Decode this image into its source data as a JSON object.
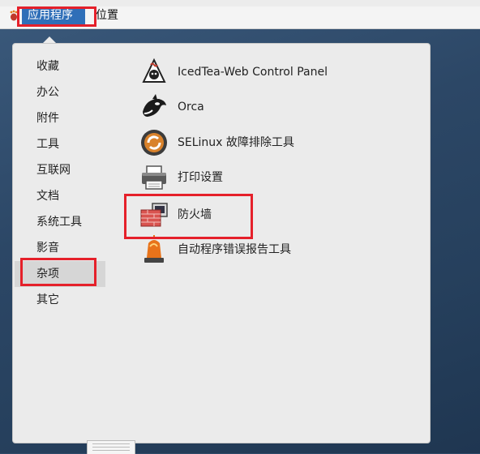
{
  "topbar": {
    "applications_label": "应用程序",
    "places_label": "位置"
  },
  "menu": {
    "categories": [
      {
        "label": "收藏"
      },
      {
        "label": "办公"
      },
      {
        "label": "附件"
      },
      {
        "label": "工具"
      },
      {
        "label": "互联网"
      },
      {
        "label": "文档"
      },
      {
        "label": "系统工具"
      },
      {
        "label": "影音"
      },
      {
        "label": "杂项",
        "selected": true
      },
      {
        "label": "其它"
      }
    ],
    "apps": [
      {
        "label": "IcedTea-Web Control Panel",
        "icon": "java-icon"
      },
      {
        "label": "Orca",
        "icon": "orca-icon"
      },
      {
        "label": "SELinux 故障排除工具",
        "icon": "selinux-icon"
      },
      {
        "label": "打印设置",
        "icon": "printer-icon"
      },
      {
        "label": "防火墙",
        "icon": "firewall-icon"
      },
      {
        "label": "自动程序错误报告工具",
        "icon": "warning-light-icon"
      }
    ]
  },
  "colors": {
    "accent": "#2f6fb8",
    "highlight_box": "#e5202a",
    "menu_bg": "#ebebeb",
    "selected_bg": "#d6d6d6"
  }
}
